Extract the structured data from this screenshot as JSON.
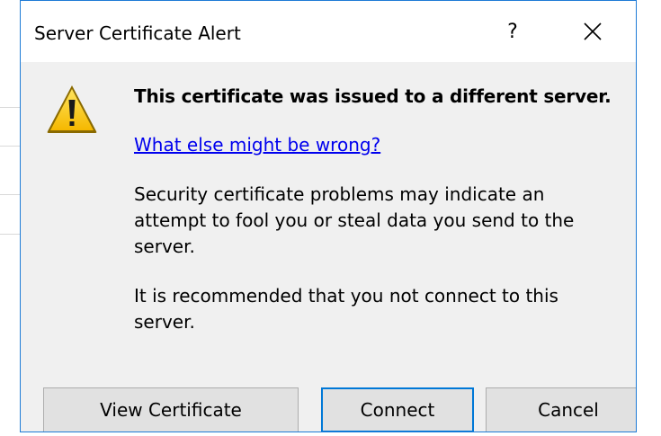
{
  "dialog": {
    "title": "Server Certificate Alert",
    "help_label": "?",
    "close_icon": "close-icon",
    "warning_icon": "warning-triangle-icon",
    "heading": "This certificate was issued to a different server.",
    "link_text": "What else might be wrong?",
    "paragraph1": "Security certificate problems may indicate an attempt to fool you or steal data you send to the server.",
    "paragraph2": "It is recommended that you not connect to this server.",
    "buttons": {
      "view_certificate": "View Certificate",
      "connect": "Connect",
      "cancel": "Cancel"
    }
  },
  "colors": {
    "dialog_border": "#1e7bd6",
    "link": "#0000ee",
    "focus_border": "#0078d7",
    "warning_fill": "#ffd11a",
    "button_bg": "#e1e1e1",
    "content_bg": "#f0f0f0"
  }
}
